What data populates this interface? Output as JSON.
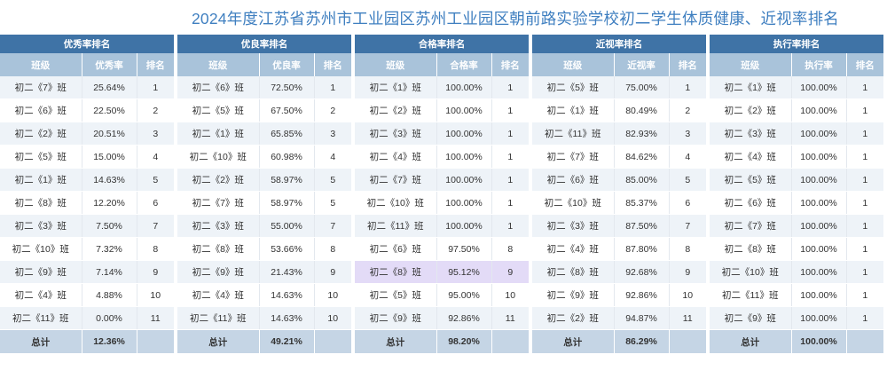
{
  "title": "2024年度江苏省苏州市工业园区苏州工业园区朝前路实验学校初二学生体质健康、近视率排名",
  "columns": {
    "class": "班级",
    "rank": "排名",
    "total": "总计"
  },
  "panels": [
    {
      "header": "优秀率排名",
      "rate_label": "优秀率",
      "total_rate": "12.36%",
      "rows": [
        {
          "class": "初二《7》班",
          "rate": "25.64%",
          "rank": "1"
        },
        {
          "class": "初二《6》班",
          "rate": "22.50%",
          "rank": "2"
        },
        {
          "class": "初二《2》班",
          "rate": "20.51%",
          "rank": "3"
        },
        {
          "class": "初二《5》班",
          "rate": "15.00%",
          "rank": "4"
        },
        {
          "class": "初二《1》班",
          "rate": "14.63%",
          "rank": "5"
        },
        {
          "class": "初二《8》班",
          "rate": "12.20%",
          "rank": "6"
        },
        {
          "class": "初二《3》班",
          "rate": "7.50%",
          "rank": "7"
        },
        {
          "class": "初二《10》班",
          "rate": "7.32%",
          "rank": "8"
        },
        {
          "class": "初二《9》班",
          "rate": "7.14%",
          "rank": "9"
        },
        {
          "class": "初二《4》班",
          "rate": "4.88%",
          "rank": "10"
        },
        {
          "class": "初二《11》班",
          "rate": "0.00%",
          "rank": "11"
        }
      ]
    },
    {
      "header": "优良率排名",
      "rate_label": "优良率",
      "total_rate": "49.21%",
      "rows": [
        {
          "class": "初二《6》班",
          "rate": "72.50%",
          "rank": "1"
        },
        {
          "class": "初二《5》班",
          "rate": "67.50%",
          "rank": "2"
        },
        {
          "class": "初二《1》班",
          "rate": "65.85%",
          "rank": "3"
        },
        {
          "class": "初二《10》班",
          "rate": "60.98%",
          "rank": "4"
        },
        {
          "class": "初二《2》班",
          "rate": "58.97%",
          "rank": "5"
        },
        {
          "class": "初二《7》班",
          "rate": "58.97%",
          "rank": "5"
        },
        {
          "class": "初二《3》班",
          "rate": "55.00%",
          "rank": "7"
        },
        {
          "class": "初二《8》班",
          "rate": "53.66%",
          "rank": "8"
        },
        {
          "class": "初二《9》班",
          "rate": "21.43%",
          "rank": "9"
        },
        {
          "class": "初二《4》班",
          "rate": "14.63%",
          "rank": "10"
        },
        {
          "class": "初二《11》班",
          "rate": "14.63%",
          "rank": "10"
        }
      ]
    },
    {
      "header": "合格率排名",
      "rate_label": "合格率",
      "total_rate": "98.20%",
      "rows": [
        {
          "class": "初二《1》班",
          "rate": "100.00%",
          "rank": "1"
        },
        {
          "class": "初二《2》班",
          "rate": "100.00%",
          "rank": "1"
        },
        {
          "class": "初二《3》班",
          "rate": "100.00%",
          "rank": "1"
        },
        {
          "class": "初二《4》班",
          "rate": "100.00%",
          "rank": "1"
        },
        {
          "class": "初二《7》班",
          "rate": "100.00%",
          "rank": "1"
        },
        {
          "class": "初二《10》班",
          "rate": "100.00%",
          "rank": "1"
        },
        {
          "class": "初二《11》班",
          "rate": "100.00%",
          "rank": "1"
        },
        {
          "class": "初二《6》班",
          "rate": "97.50%",
          "rank": "8"
        },
        {
          "class": "初二《8》班",
          "rate": "95.12%",
          "rank": "9",
          "highlight": true
        },
        {
          "class": "初二《5》班",
          "rate": "95.00%",
          "rank": "10"
        },
        {
          "class": "初二《9》班",
          "rate": "92.86%",
          "rank": "11"
        }
      ]
    },
    {
      "header": "近视率排名",
      "rate_label": "近视率",
      "total_rate": "86.29%",
      "rows": [
        {
          "class": "初二《5》班",
          "rate": "75.00%",
          "rank": "1"
        },
        {
          "class": "初二《1》班",
          "rate": "80.49%",
          "rank": "2"
        },
        {
          "class": "初二《11》班",
          "rate": "82.93%",
          "rank": "3"
        },
        {
          "class": "初二《7》班",
          "rate": "84.62%",
          "rank": "4"
        },
        {
          "class": "初二《6》班",
          "rate": "85.00%",
          "rank": "5"
        },
        {
          "class": "初二《10》班",
          "rate": "85.37%",
          "rank": "6"
        },
        {
          "class": "初二《3》班",
          "rate": "87.50%",
          "rank": "7"
        },
        {
          "class": "初二《4》班",
          "rate": "87.80%",
          "rank": "8"
        },
        {
          "class": "初二《8》班",
          "rate": "92.68%",
          "rank": "9"
        },
        {
          "class": "初二《9》班",
          "rate": "92.86%",
          "rank": "10"
        },
        {
          "class": "初二《2》班",
          "rate": "94.87%",
          "rank": "11"
        }
      ]
    },
    {
      "header": "执行率排名",
      "rate_label": "执行率",
      "total_rate": "100.00%",
      "rows": [
        {
          "class": "初二《1》班",
          "rate": "100.00%",
          "rank": "1"
        },
        {
          "class": "初二《2》班",
          "rate": "100.00%",
          "rank": "1"
        },
        {
          "class": "初二《3》班",
          "rate": "100.00%",
          "rank": "1"
        },
        {
          "class": "初二《4》班",
          "rate": "100.00%",
          "rank": "1"
        },
        {
          "class": "初二《5》班",
          "rate": "100.00%",
          "rank": "1"
        },
        {
          "class": "初二《6》班",
          "rate": "100.00%",
          "rank": "1"
        },
        {
          "class": "初二《7》班",
          "rate": "100.00%",
          "rank": "1"
        },
        {
          "class": "初二《8》班",
          "rate": "100.00%",
          "rank": "1"
        },
        {
          "class": "初二《10》班",
          "rate": "100.00%",
          "rank": "1"
        },
        {
          "class": "初二《11》班",
          "rate": "100.00%",
          "rank": "1"
        },
        {
          "class": "初二《9》班",
          "rate": "100.00%",
          "rank": "1"
        }
      ]
    }
  ]
}
